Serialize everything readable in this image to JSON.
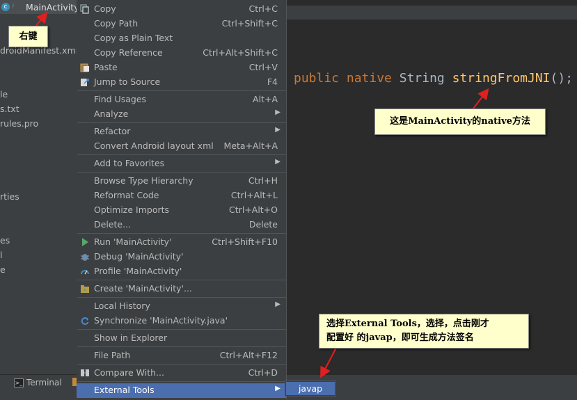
{
  "tree": {
    "title": "MainActivity",
    "rows": [
      "droidManifest.xml",
      "le",
      "s.txt",
      "rules.pro",
      "rties",
      "es",
      "l",
      "e"
    ]
  },
  "editor": {
    "code": {
      "kw1": "public",
      "kw2": "native",
      "type": "String",
      "fn": "stringFromJNI",
      "punct": "();"
    }
  },
  "menu": {
    "items": [
      {
        "label": "Copy",
        "shortcut": "Ctrl+C",
        "icon": "copy-icon"
      },
      {
        "label": "Copy Path",
        "shortcut": "Ctrl+Shift+C"
      },
      {
        "label": "Copy as Plain Text",
        "shortcut": ""
      },
      {
        "label": "Copy Reference",
        "shortcut": "Ctrl+Alt+Shift+C"
      },
      {
        "label": "Paste",
        "shortcut": "Ctrl+V",
        "icon": "paste-icon"
      },
      {
        "label": "Jump to Source",
        "shortcut": "F4",
        "icon": "jump-icon"
      },
      {
        "label": "Find Usages",
        "shortcut": "Alt+A"
      },
      {
        "label": "Analyze",
        "shortcut": ""
      },
      {
        "label": "Refactor",
        "shortcut": ""
      },
      {
        "label": "Convert Android layout xml",
        "shortcut": "Meta+Alt+A"
      },
      {
        "label": "Add to Favorites",
        "shortcut": ""
      },
      {
        "label": "Browse Type Hierarchy",
        "shortcut": "Ctrl+H"
      },
      {
        "label": "Reformat Code",
        "shortcut": "Ctrl+Alt+L"
      },
      {
        "label": "Optimize Imports",
        "shortcut": "Ctrl+Alt+O"
      },
      {
        "label": "Delete...",
        "shortcut": "Delete"
      },
      {
        "label": "Run 'MainActivity'",
        "shortcut": "Ctrl+Shift+F10",
        "icon": "run-icon"
      },
      {
        "label": "Debug 'MainActivity'",
        "shortcut": "",
        "icon": "debug-icon"
      },
      {
        "label": "Profile 'MainActivity'",
        "shortcut": "",
        "icon": "profile-icon"
      },
      {
        "label": "Create 'MainActivity'...",
        "shortcut": "",
        "icon": "create-icon"
      },
      {
        "label": "Local History",
        "shortcut": ""
      },
      {
        "label": "Synchronize 'MainActivity.java'",
        "shortcut": "",
        "icon": "sync-icon"
      },
      {
        "label": "Show in Explorer",
        "shortcut": ""
      },
      {
        "label": "File Path",
        "shortcut": "Ctrl+Alt+F12"
      },
      {
        "label": "Compare With...",
        "shortcut": "Ctrl+D",
        "icon": "compare-icon"
      },
      {
        "label": "External Tools",
        "shortcut": ""
      }
    ]
  },
  "submenu": {
    "item": "javap"
  },
  "bottombar": {
    "terminal": "Terminal"
  },
  "notes": {
    "right_click": "右键",
    "native_method": "这是MainActivity的native方法",
    "external_tools_line1": "选择External Tools，选择，点击刚才",
    "external_tools_line2": "配置好 的javap，即可生成方法签名"
  },
  "colors": {
    "selection": "#4b6eaf",
    "note_bg": "#ffffcc",
    "arrow": "#e02020"
  }
}
